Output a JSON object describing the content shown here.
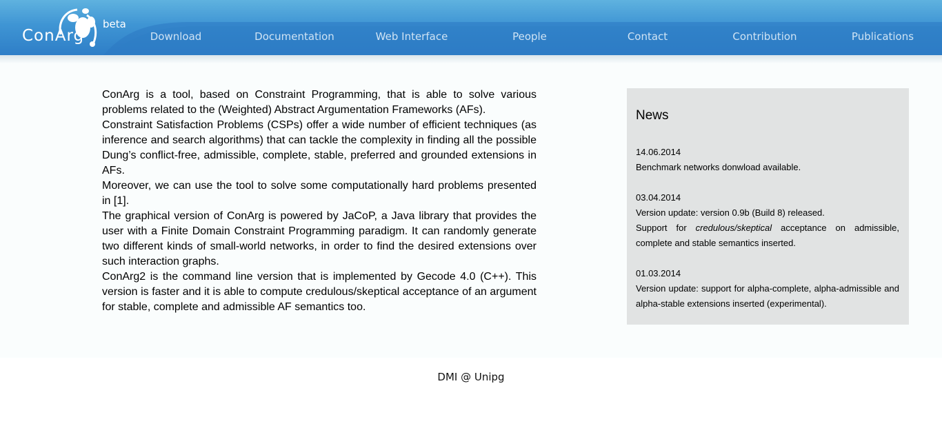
{
  "header": {
    "logo_text": "ConArg",
    "beta_label": "beta",
    "nav": [
      {
        "label": "Download"
      },
      {
        "label": "Documentation"
      },
      {
        "label": "Web Interface"
      },
      {
        "label": "People"
      },
      {
        "label": "Contact"
      },
      {
        "label": "Contribution"
      },
      {
        "label": "Publications"
      }
    ]
  },
  "main": {
    "intro": [
      "ConArg is a tool, based on Constraint Programming, that is able to solve various problems related to the (Weighted) Abstract Argumentation Frameworks (AFs).",
      "Constraint Satisfaction Problems (CSPs) offer a wide number of efficient techniques (as inference and search algorithms) that can tackle the complexity in finding all the possible Dung’s conflict-free, admissible, complete, stable, preferred and grounded extensions in AFs.",
      "Moreover, we can use the tool to solve some computationally hard problems presented in [1].",
      "The graphical version of ConArg is powered by JaCoP, a Java library that provides the user with a Finite Domain Constraint Programming paradigm. It can randomly generate two different kinds of small-world networks, in order to find the desired extensions over such interaction graphs.",
      "ConArg2 is the command line version that is implemented by Gecode 4.0 (C++). This version is faster and it is able to compute credulous/skeptical acceptance of an argument for stable, complete and admissible AF semantics too."
    ]
  },
  "news": {
    "title": "News",
    "items": [
      {
        "date": "14.06.2014",
        "text": "Benchmark networks donwload available."
      },
      {
        "date": "03.04.2014",
        "text": "Version update: version 0.9b (Build 8) released.",
        "text2_before": "Support for ",
        "text2_em": "credulous/skeptical",
        "text2_after": " acceptance on admissible, complete and stable semantics inserted."
      },
      {
        "date": "01.03.2014",
        "text": "Version update: support for alpha-complete, alpha-admissible and alpha-stable extensions inserted (experimental)."
      }
    ]
  },
  "footer": {
    "text": "DMI @ Unipg"
  },
  "colors": {
    "header_top": "#5fb2df",
    "header_bottom": "#2e7ec7",
    "nav_text": "#cfe3f4",
    "news_background": "#e1e3e3",
    "main_background": "#fafdfd"
  }
}
